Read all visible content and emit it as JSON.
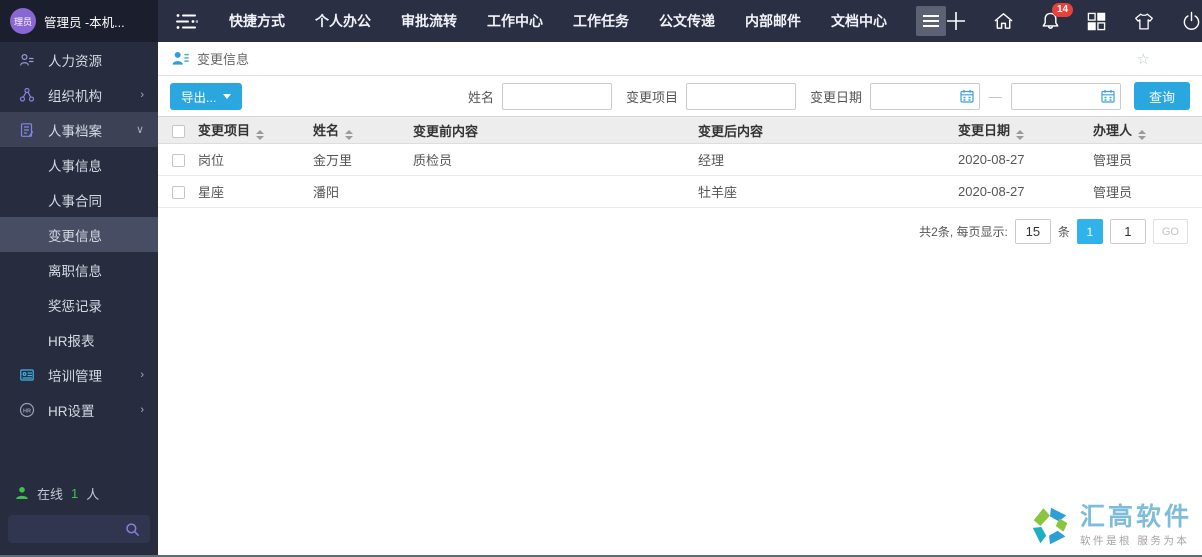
{
  "topbar": {
    "avatar_text": "理员",
    "user_label": "管理员 -本机...",
    "nav_items": [
      "快捷方式",
      "个人办公",
      "审批流转",
      "工作中心",
      "工作任务",
      "公文传递",
      "内部邮件",
      "文档中心"
    ],
    "notification_count": "14"
  },
  "sidebar": {
    "items": [
      {
        "label": "人力资源"
      },
      {
        "label": "组织机构",
        "arrow": "›"
      },
      {
        "label": "人事档案",
        "arrow": "∨"
      },
      {
        "label": "人事信息"
      },
      {
        "label": "人事合同"
      },
      {
        "label": "变更信息"
      },
      {
        "label": "离职信息"
      },
      {
        "label": "奖惩记录"
      },
      {
        "label": "HR报表"
      },
      {
        "label": "培训管理",
        "arrow": "›"
      },
      {
        "label": "HR设置",
        "arrow": "›"
      }
    ],
    "online_label": "在线",
    "online_count": "1",
    "online_unit": "人"
  },
  "page": {
    "title": "变更信息"
  },
  "toolbar": {
    "export_label": "导出...",
    "name_label": "姓名",
    "name_value": "",
    "item_label": "变更项目",
    "item_value": "",
    "date_label": "变更日期",
    "date_from": "",
    "date_to": "",
    "search_label": "查询"
  },
  "table": {
    "columns": [
      {
        "label": "变更项目"
      },
      {
        "label": "姓名"
      },
      {
        "label": "变更前内容"
      },
      {
        "label": "变更后内容"
      },
      {
        "label": "变更日期"
      },
      {
        "label": "办理人"
      }
    ],
    "rows": [
      [
        "岗位",
        "金万里",
        "质检员",
        "经理",
        "2020-08-27",
        "管理员"
      ],
      [
        "星座",
        "潘阳",
        "",
        "牡羊座",
        "2020-08-27",
        "管理员"
      ]
    ]
  },
  "pagination": {
    "summary": "共2条, 每页显示:",
    "page_size": "15",
    "unit": "条",
    "current_page": "1",
    "goto_value": "1",
    "go_label": "GO"
  },
  "footer": {
    "brand": "汇高软件",
    "slogan": "软件是根  服务为本"
  },
  "colors": {
    "accent": "#2ba7e0",
    "badge_red": "#e8413c",
    "page_active": "#2fb3ea",
    "topbar_bg": "#2a2f43",
    "sidebar_bg": "#272c3e"
  }
}
